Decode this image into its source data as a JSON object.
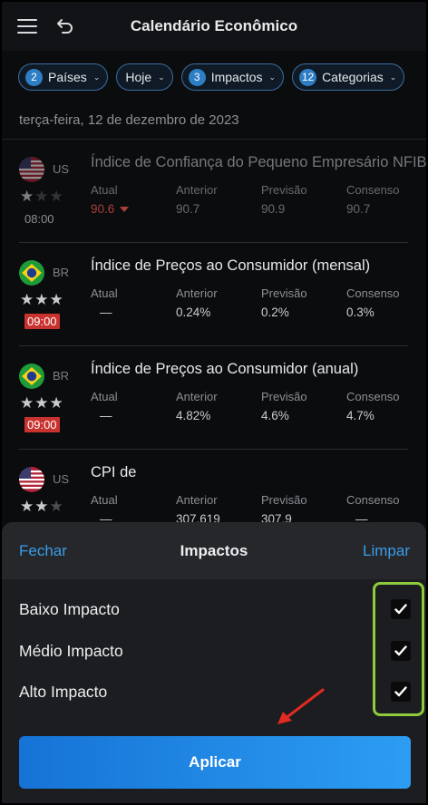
{
  "header": {
    "title": "Calendário Econômico"
  },
  "filters": [
    {
      "count": "2",
      "label": "Países"
    },
    {
      "count": "",
      "label": "Hoje"
    },
    {
      "count": "3",
      "label": "Impactos"
    },
    {
      "count": "12",
      "label": "Categorias"
    }
  ],
  "date": "terça-feira, 12 de dezembro de 2023",
  "columns": {
    "actual": "Atual",
    "previous": "Anterior",
    "forecast": "Previsão",
    "consensus": "Consenso"
  },
  "events": [
    {
      "country": "US",
      "time": "08:00",
      "stars": 1,
      "title": "Índice de Confiança do Pequeno Empresário NFIB",
      "actual": "90.6",
      "previous": "90.7",
      "forecast": "90.9",
      "consensus": "90.7"
    },
    {
      "country": "BR",
      "time": "09:00",
      "stars": 3,
      "title": "Índice de Preços ao Consumidor (mensal)",
      "actual": "—",
      "previous": "0.24%",
      "forecast": "0.2%",
      "consensus": "0.3%"
    },
    {
      "country": "BR",
      "time": "09:00",
      "stars": 3,
      "title": "Índice de Preços ao Consumidor (anual)",
      "actual": "—",
      "previous": "4.82%",
      "forecast": "4.6%",
      "consensus": "4.7%"
    },
    {
      "country": "US",
      "time": "",
      "stars": 2,
      "title": "CPI de",
      "actual": "—",
      "previous": "307.619",
      "forecast": "307.9",
      "consensus": "—"
    }
  ],
  "sheet": {
    "close": "Fechar",
    "title": "Impactos",
    "clear": "Limpar",
    "options": [
      {
        "label": "Baixo Impacto",
        "checked": true
      },
      {
        "label": "Médio Impacto",
        "checked": true
      },
      {
        "label": "Alto Impacto",
        "checked": true
      }
    ],
    "apply": "Aplicar"
  },
  "colors": {
    "accent": "#3b9de8",
    "highlight": "#8ecb3c",
    "negative": "#e0483f",
    "time_badge": "#c8322f"
  }
}
